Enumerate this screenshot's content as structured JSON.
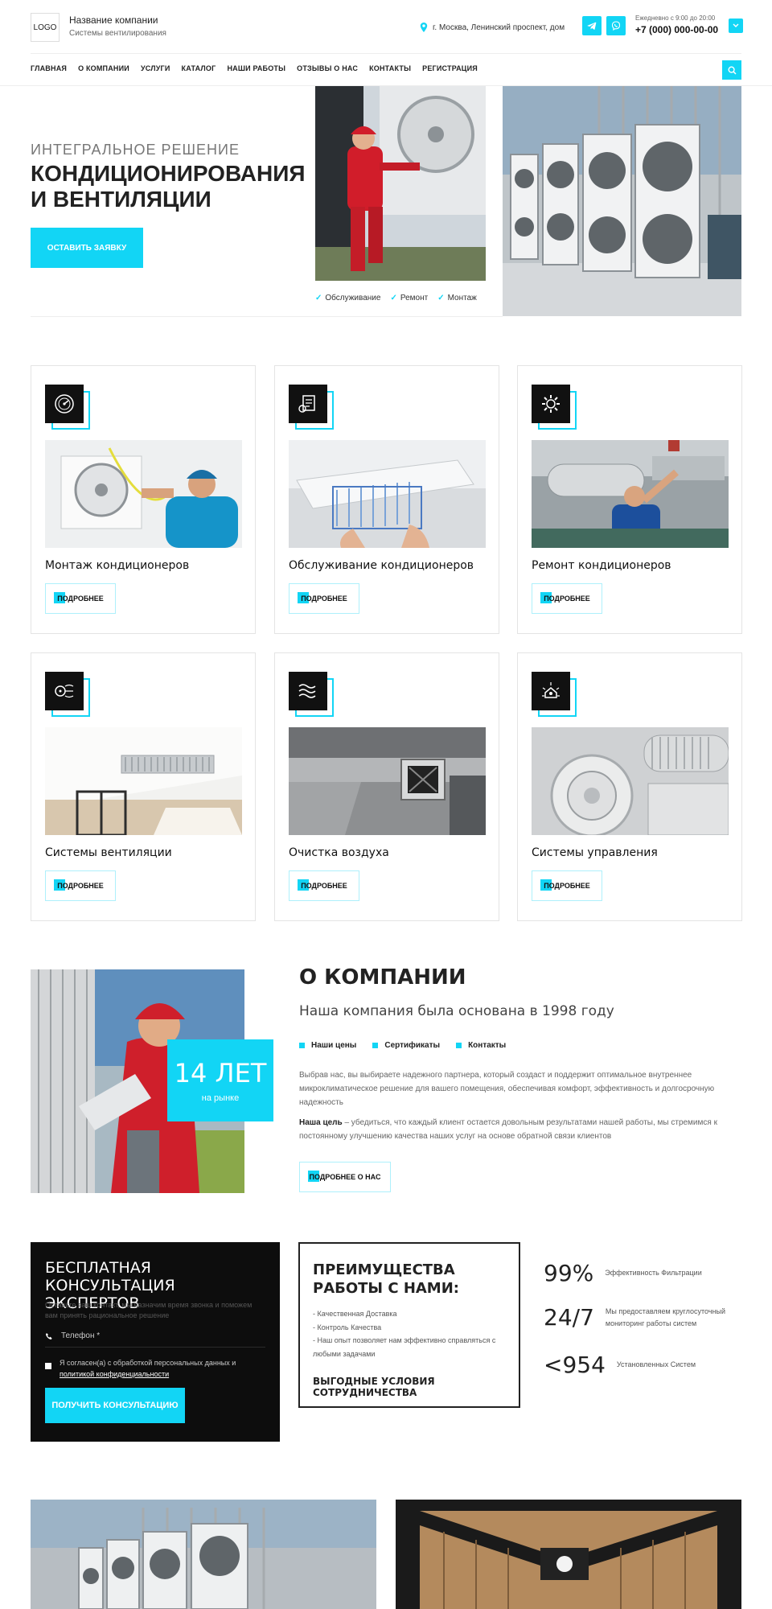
{
  "header": {
    "logo": "LOGO",
    "company_name": "Название компании",
    "company_sub": "Системы вентилирования",
    "address": "г. Москва, Ленинский проспект, дом",
    "hours": "Ежедневно с 9:00 до 20:00",
    "phone": "+7 (000) 000-00-00",
    "accent": "#12d5f5"
  },
  "nav": [
    "ГЛАВНАЯ",
    "О КОМПАНИИ",
    "УСЛУГИ",
    "КАТАЛОГ",
    "НАШИ РАБОТЫ",
    "ОТЗЫВЫ О НАС",
    "КОНТАКТЫ",
    "РЕГИСТРАЦИЯ"
  ],
  "hero": {
    "eyebrow": "ИНТЕГРАЛЬНОЕ РЕШЕНИЕ",
    "title": "КОНДИЦИОНИРОВАНИЯ И ВЕНТИЛЯЦИИ",
    "button": "ОСТАВИТЬ ЗАЯВКУ",
    "tags": [
      "Обслуживание",
      "Ремонт",
      "Монтаж"
    ]
  },
  "services": [
    {
      "title": "Монтаж кондиционеров",
      "more": "ПОДРОБНЕЕ",
      "icon": "gauge-icon"
    },
    {
      "title": "Обслуживание кондиционеров",
      "more": "ПОДРОБНЕЕ",
      "icon": "document-icon"
    },
    {
      "title": "Ремонт кондиционеров",
      "more": "ПОДРОБНЕЕ",
      "icon": "gear-icon"
    },
    {
      "title": "Системы вентиляции",
      "more": "ПОДРОБНЕЕ",
      "icon": "airflow-fan-icon"
    },
    {
      "title": "Очистка воздуха",
      "more": "ПОДРОБНЕЕ",
      "icon": "waves-icon"
    },
    {
      "title": "Системы управления",
      "more": "ПОДРОБНЕЕ",
      "icon": "smart-home-icon"
    }
  ],
  "about": {
    "badge_big": "14 ЛЕТ",
    "badge_small": "на рынке",
    "title": "О КОМПАНИИ",
    "subtitle": "Наша компания была основана в 1998 году",
    "links": [
      "Наши цены",
      "Сертификаты",
      "Контакты"
    ],
    "p1": "Выбрав нас, вы выбираете надежного партнера, который создаст и поддержит оптимальное внутреннее микроклиматическое решение для вашего помещения, обеспечивая комфорт, эффективность и долгосрочную надежность",
    "p2_bold": "Наша цель",
    "p2": " – убедиться, что каждый клиент остается довольным результатами нашей работы, мы стремимся к постоянному улучшению качества наших услуг на основе обратной связи клиентов",
    "button": "ПОДРОБНЕЕ О НАС"
  },
  "consult": {
    "title": "БЕСПЛАТНАЯ КОНСУЛЬТАЦИЯ ЭКСПЕРТОВ",
    "sub": "Оставьте ваш контакт, мы назначим время звонка и поможем вам принять рациональное решение",
    "phone_placeholder": "Телефон *",
    "agree": "Я согласен(а) с обработкой персональных данных и",
    "agree_link": "политикой конфиденциальности",
    "button": "ПОЛУЧИТЬ КОНСУЛЬТАЦИЮ"
  },
  "advantages": {
    "title": "ПРЕИМУЩЕСТВА РАБОТЫ С НАМИ:",
    "items": [
      "- Качественная Доставка",
      "- Контроль Качества",
      "- Наш опыт позволяет нам эффективно справляться с любыми задачами"
    ],
    "footer": "ВЫГОДНЫЕ УСЛОВИЯ СОТРУДНИЧЕСТВА"
  },
  "stats": [
    {
      "num": "99%",
      "label": "Эффективность Фильтрации"
    },
    {
      "num": "24/7",
      "label": "Мы предоставляем круглосуточный мониторинг работы систем"
    },
    {
      "num": "<954",
      "label": "Установленных Систем"
    }
  ]
}
